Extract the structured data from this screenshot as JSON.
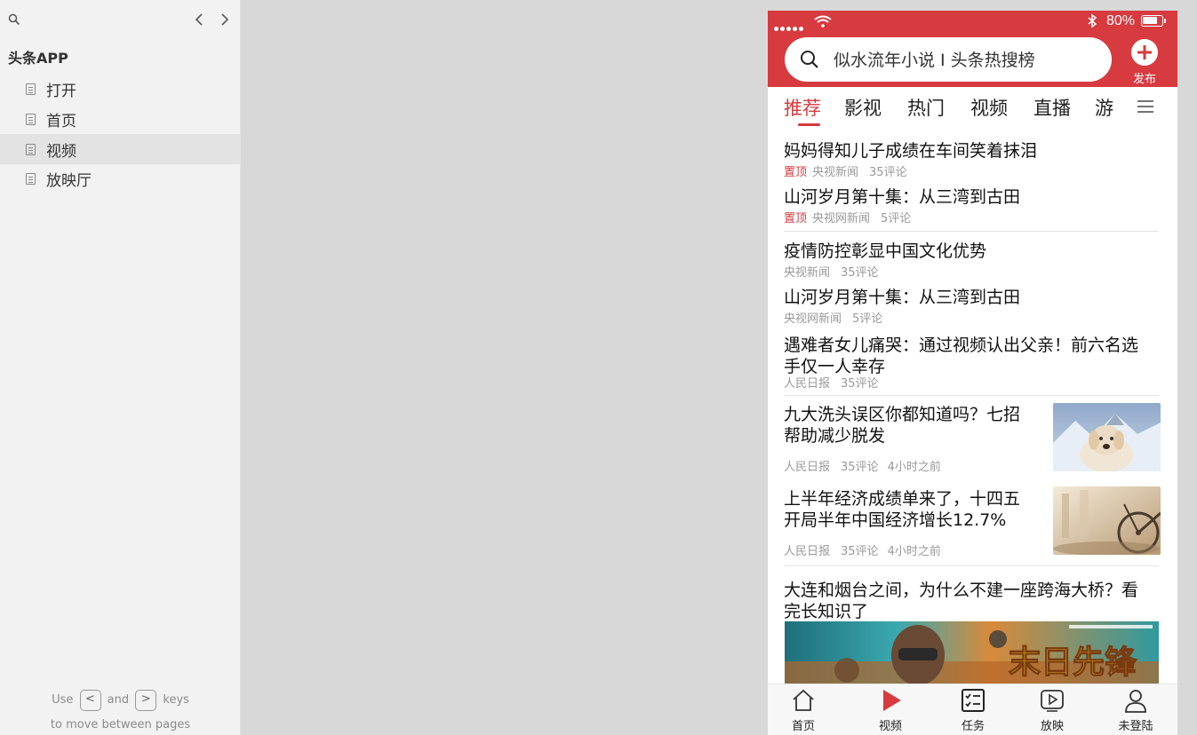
{
  "sidebar": {
    "project_title": "头条APP",
    "pages": [
      {
        "label": "打开",
        "active": false
      },
      {
        "label": "首页",
        "active": false
      },
      {
        "label": "视频",
        "active": true
      },
      {
        "label": "放映厅",
        "active": false
      }
    ],
    "help": {
      "use": "Use",
      "prev_key": "<",
      "and": "and",
      "next_key": ">",
      "keys": "keys",
      "line2": "to move between pages"
    }
  },
  "phone": {
    "status": {
      "battery_text": "80%",
      "battery_level": 0.8
    },
    "search": {
      "placeholder": "似水流年小说 I 头条热搜榜"
    },
    "publish_label": "发布",
    "tabs": [
      "推荐",
      "影视",
      "热门",
      "视频",
      "直播",
      "游"
    ],
    "active_tab": "推荐",
    "feed": [
      {
        "title": "妈妈得知儿子成绩在车间笑着抹泪",
        "pinned": "置顶",
        "source": "央视新闻",
        "comments": "35评论"
      },
      {
        "title": "山河岁月第十集：从三湾到古田",
        "pinned": "置顶",
        "source": "央视网新闻",
        "comments": "5评论"
      },
      {
        "title": "疫情防控彰显中国文化优势",
        "source": "央视新闻",
        "comments": "35评论"
      },
      {
        "title": "山河岁月第十集：从三湾到古田",
        "source": "央视网新闻",
        "comments": "5评论"
      },
      {
        "title_line1": "遇难者女儿痛哭：通过视频认出父亲！前六名选",
        "title_line2": "手仅一人幸存",
        "source": "人民日报",
        "comments": "35评论"
      },
      {
        "title_line1": "九大洗头误区你都知道吗？七招",
        "title_line2": "帮助减少脱发",
        "source": "人民日报",
        "comments": "35评论",
        "time": "4小时之前",
        "thumb": "puppy-snow-photo"
      },
      {
        "title_line1": "上半年经济成绩单来了，十四五",
        "title_line2": "开局半年中国经济增长12.7%",
        "source": "人民日报",
        "comments": "35评论",
        "time": "4小时之前",
        "thumb": "bicycle-street-photo"
      },
      {
        "title_line1": "大连和烟台之间，为什么不建一座跨海大桥？看",
        "title_line2": "完长知识了",
        "banner": "movie-poster",
        "banner_text": "末日先锋"
      }
    ]
  },
  "bottom_nav": [
    {
      "label": "首页",
      "icon": "home-icon"
    },
    {
      "label": "视频",
      "icon": "play-icon",
      "active": true
    },
    {
      "label": "任务",
      "icon": "task-list-icon"
    },
    {
      "label": "放映",
      "icon": "screen-play-icon"
    },
    {
      "label": "未登陆",
      "icon": "user-icon"
    }
  ],
  "colors": {
    "brand_red": "#d73a3f",
    "sidebar_bg": "#f2f2f2",
    "canvas_bg": "#d8d8d8",
    "meta_gray": "#999999"
  }
}
